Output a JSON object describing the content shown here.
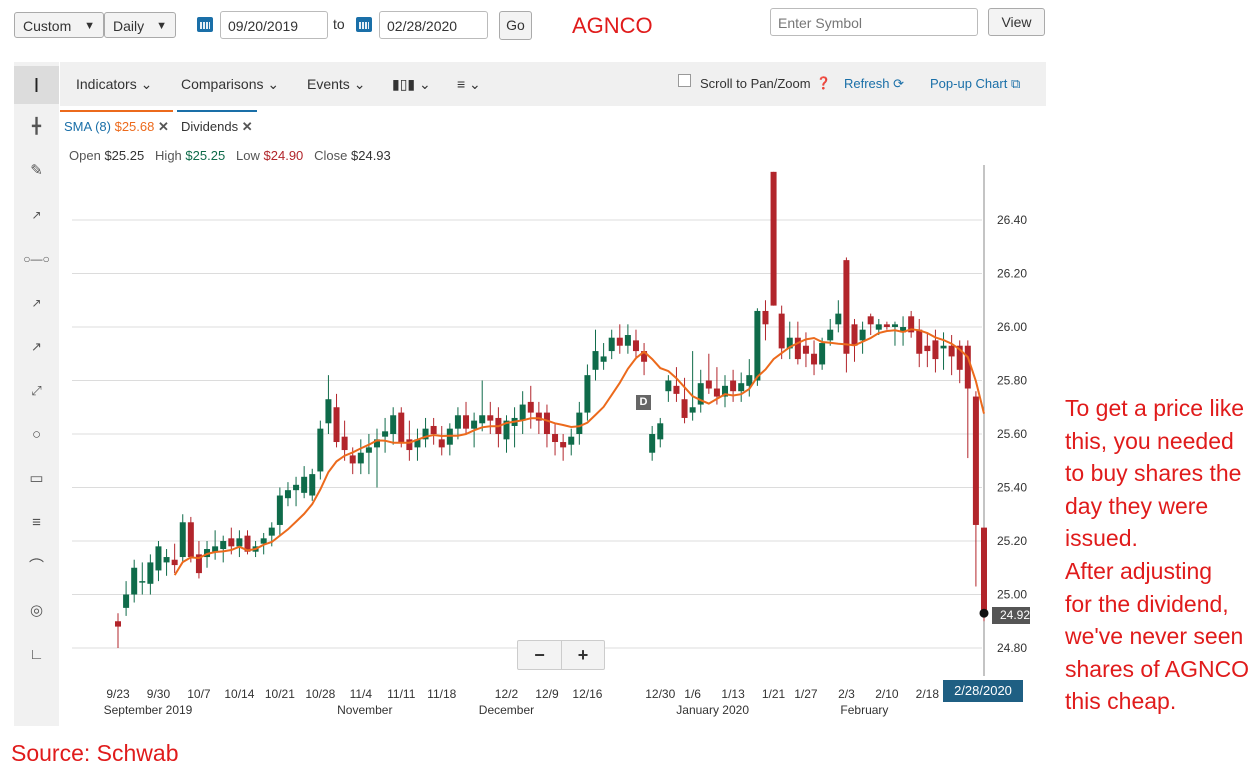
{
  "header": {
    "range_select": "Custom",
    "interval_select": "Daily",
    "start_date": "09/20/2019",
    "to_label": "to",
    "end_date": "02/28/2020",
    "go_label": "Go",
    "symbol": "AGNCO",
    "symbol_color": "#e01b1b",
    "symbol_input_placeholder": "Enter Symbol",
    "view_label": "View"
  },
  "toolbar": {
    "indicators": "Indicators",
    "comparisons": "Comparisons",
    "events": "Events",
    "scroll_label": "Scroll to Pan/Zoom",
    "refresh": "Refresh",
    "popup": "Pop-up Chart"
  },
  "legend": {
    "sma_label": "SMA (8)",
    "sma_value": "$25.68",
    "dividends": "Dividends"
  },
  "ohlc": {
    "open_label": "Open",
    "open": "$25.25",
    "high_label": "High",
    "high": "$25.25",
    "low_label": "Low",
    "low": "$24.90",
    "close_label": "Close",
    "close": "$24.93"
  },
  "zoom": {
    "minus": "−",
    "plus": "+"
  },
  "dividend_marker": "D",
  "last_price": "24.92",
  "current_date": "2/28/2020",
  "annotation": [
    "To get a price like",
    "this, you needed",
    "to buy shares the",
    "day they were",
    "issued.",
    "After adjusting",
    "for the dividend,",
    "we've never seen",
    "shares of AGNCO",
    "this cheap."
  ],
  "source": "Source: Schwab",
  "colors": {
    "up": "#0f6b4a",
    "down": "#b2252b",
    "sma": "#ec6a1c",
    "link": "#1a6fa8",
    "note": "#e01b1b"
  },
  "chart_data": {
    "type": "candlestick",
    "ylim": [
      24.7,
      26.58
    ],
    "yticks": [
      24.8,
      25.0,
      25.2,
      25.4,
      25.6,
      25.8,
      26.0,
      26.2,
      26.4
    ],
    "xtick_labels": [
      "9/23",
      "9/30",
      "10/7",
      "10/14",
      "10/21",
      "10/28",
      "11/4",
      "11/11",
      "11/18",
      "12/2",
      "12/9",
      "12/16",
      "12/30",
      "1/6",
      "1/13",
      "1/21",
      "1/27",
      "2/3",
      "2/10",
      "2/18"
    ],
    "month_labels": [
      "September 2019",
      "November",
      "December",
      "January 2020",
      "February"
    ],
    "candles": [
      [
        "9/23",
        24.9,
        24.93,
        24.8,
        24.88
      ],
      [
        "9/24",
        24.95,
        25.05,
        24.92,
        25.0
      ],
      [
        "9/25",
        25.0,
        25.13,
        24.97,
        25.1
      ],
      [
        "9/26",
        25.05,
        25.12,
        25.0,
        25.05
      ],
      [
        "9/27",
        25.04,
        25.15,
        25.0,
        25.12
      ],
      [
        "9/30",
        25.09,
        25.2,
        25.05,
        25.18
      ],
      [
        "10/1",
        25.12,
        25.17,
        25.07,
        25.14
      ],
      [
        "10/2",
        25.13,
        25.19,
        25.08,
        25.11
      ],
      [
        "10/3",
        25.14,
        25.3,
        25.12,
        25.27
      ],
      [
        "10/4",
        25.27,
        25.29,
        25.12,
        25.14
      ],
      [
        "10/7",
        25.15,
        25.2,
        25.06,
        25.08
      ],
      [
        "10/8",
        25.14,
        25.2,
        25.1,
        25.17
      ],
      [
        "10/9",
        25.16,
        25.24,
        25.13,
        25.18
      ],
      [
        "10/10",
        25.17,
        25.22,
        25.12,
        25.2
      ],
      [
        "10/11",
        25.21,
        25.25,
        25.15,
        25.18
      ],
      [
        "10/14",
        25.18,
        25.24,
        25.14,
        25.21
      ],
      [
        "10/15",
        25.22,
        25.24,
        25.15,
        25.16
      ],
      [
        "10/16",
        25.16,
        25.2,
        25.14,
        25.18
      ],
      [
        "10/17",
        25.19,
        25.23,
        25.15,
        25.21
      ],
      [
        "10/18",
        25.22,
        25.27,
        25.18,
        25.25
      ],
      [
        "10/21",
        25.26,
        25.4,
        25.22,
        25.37
      ],
      [
        "10/22",
        25.36,
        25.42,
        25.33,
        25.39
      ],
      [
        "10/23",
        25.39,
        25.44,
        25.33,
        25.41
      ],
      [
        "10/24",
        25.38,
        25.48,
        25.36,
        25.44
      ],
      [
        "10/25",
        25.37,
        25.47,
        25.35,
        25.45
      ],
      [
        "10/28",
        25.46,
        25.65,
        25.43,
        25.62
      ],
      [
        "10/29",
        25.64,
        25.82,
        25.6,
        25.73
      ],
      [
        "10/30",
        25.7,
        25.75,
        25.55,
        25.57
      ],
      [
        "10/31",
        25.59,
        25.65,
        25.5,
        25.54
      ],
      [
        "11/1",
        25.52,
        25.55,
        25.45,
        25.49
      ],
      [
        "11/4",
        25.49,
        25.58,
        25.45,
        25.53
      ],
      [
        "11/5",
        25.53,
        25.6,
        25.45,
        25.55
      ],
      [
        "11/6",
        25.55,
        25.62,
        25.4,
        25.58
      ],
      [
        "11/7",
        25.59,
        25.66,
        25.53,
        25.61
      ],
      [
        "11/8",
        25.6,
        25.7,
        25.56,
        25.67
      ],
      [
        "11/11",
        25.68,
        25.7,
        25.55,
        25.57
      ],
      [
        "11/12",
        25.58,
        25.65,
        25.5,
        25.54
      ],
      [
        "11/13",
        25.55,
        25.62,
        25.5,
        25.58
      ],
      [
        "11/14",
        25.58,
        25.66,
        25.55,
        25.62
      ],
      [
        "11/15",
        25.63,
        25.66,
        25.56,
        25.6
      ],
      [
        "11/18",
        25.58,
        25.63,
        25.52,
        25.55
      ],
      [
        "11/19",
        25.56,
        25.64,
        25.52,
        25.62
      ],
      [
        "11/20",
        25.62,
        25.7,
        25.58,
        25.67
      ],
      [
        "11/21",
        25.67,
        25.72,
        25.6,
        25.62
      ],
      [
        "11/22",
        25.62,
        25.68,
        25.55,
        25.65
      ],
      [
        "11/25",
        25.64,
        25.8,
        25.61,
        25.67
      ],
      [
        "11/26",
        25.67,
        25.72,
        25.6,
        25.65
      ],
      [
        "11/27",
        25.66,
        25.7,
        25.55,
        25.6
      ],
      [
        "12/2",
        25.58,
        25.67,
        25.53,
        25.65
      ],
      [
        "12/3",
        25.63,
        25.7,
        25.55,
        25.66
      ],
      [
        "12/4",
        25.65,
        25.76,
        25.6,
        25.71
      ],
      [
        "12/5",
        25.72,
        25.78,
        25.62,
        25.68
      ],
      [
        "12/6",
        25.68,
        25.72,
        25.6,
        25.65
      ],
      [
        "12/9",
        25.68,
        25.71,
        25.55,
        25.6
      ],
      [
        "12/10",
        25.6,
        25.64,
        25.52,
        25.57
      ],
      [
        "12/11",
        25.57,
        25.6,
        25.5,
        25.55
      ],
      [
        "12/12",
        25.56,
        25.62,
        25.52,
        25.59
      ],
      [
        "12/13",
        25.6,
        25.72,
        25.56,
        25.68
      ],
      [
        "12/16",
        25.68,
        25.86,
        25.65,
        25.82
      ],
      [
        "12/17",
        25.84,
        25.99,
        25.8,
        25.91
      ],
      [
        "12/18",
        25.87,
        25.94,
        25.84,
        25.89
      ],
      [
        "12/19",
        25.91,
        25.99,
        25.88,
        25.96
      ],
      [
        "12/20",
        25.96,
        26.01,
        25.9,
        25.93
      ],
      [
        "12/23",
        25.93,
        26.01,
        25.9,
        25.97
      ],
      [
        "12/24",
        25.95,
        25.99,
        25.88,
        25.91
      ],
      [
        "12/26",
        25.91,
        25.94,
        25.82,
        25.87
      ],
      [
        "12/27",
        25.53,
        25.63,
        25.5,
        25.6
      ],
      [
        "12/30",
        25.58,
        25.66,
        25.55,
        25.64
      ],
      [
        "12/31",
        25.76,
        25.82,
        25.72,
        25.8
      ],
      [
        "1/2",
        25.78,
        25.85,
        25.72,
        25.75
      ],
      [
        "1/3",
        25.73,
        25.81,
        25.64,
        25.66
      ],
      [
        "1/6",
        25.68,
        25.91,
        25.65,
        25.7
      ],
      [
        "1/7",
        25.71,
        25.84,
        25.68,
        25.79
      ],
      [
        "1/8",
        25.8,
        25.9,
        25.75,
        25.77
      ],
      [
        "1/9",
        25.77,
        25.85,
        25.71,
        25.74
      ],
      [
        "1/10",
        25.74,
        25.82,
        25.7,
        25.78
      ],
      [
        "1/13",
        25.8,
        25.84,
        25.72,
        25.76
      ],
      [
        "1/14",
        25.76,
        25.83,
        25.72,
        25.79
      ],
      [
        "1/15",
        25.78,
        25.88,
        25.74,
        25.82
      ],
      [
        "1/16",
        25.8,
        26.07,
        25.78,
        26.06
      ],
      [
        "1/17",
        26.06,
        26.1,
        25.95,
        26.01
      ],
      [
        "1/21",
        26.58,
        26.58,
        26.08,
        26.08
      ],
      [
        "1/22",
        26.05,
        26.08,
        25.88,
        25.92
      ],
      [
        "1/23",
        25.92,
        26.02,
        25.88,
        25.96
      ],
      [
        "1/24",
        25.96,
        26.02,
        25.86,
        25.88
      ],
      [
        "1/27",
        25.93,
        25.98,
        25.85,
        25.9
      ],
      [
        "1/28",
        25.9,
        25.95,
        25.82,
        25.86
      ],
      [
        "1/29",
        25.86,
        25.96,
        25.84,
        25.94
      ],
      [
        "1/30",
        25.95,
        26.03,
        25.93,
        25.99
      ],
      [
        "1/31",
        26.01,
        26.1,
        25.98,
        26.05
      ],
      [
        "2/3",
        26.25,
        26.26,
        25.83,
        25.9
      ],
      [
        "2/4",
        26.01,
        26.03,
        25.87,
        25.93
      ],
      [
        "2/5",
        25.95,
        26.02,
        25.9,
        25.99
      ],
      [
        "2/6",
        26.04,
        26.05,
        25.97,
        26.01
      ],
      [
        "2/7",
        25.99,
        26.03,
        25.97,
        26.01
      ],
      [
        "2/10",
        26.01,
        26.02,
        25.99,
        26.0
      ],
      [
        "2/11",
        26.0,
        26.02,
        25.93,
        26.01
      ],
      [
        "2/12",
        25.98,
        26.04,
        25.93,
        26.0
      ],
      [
        "2/13",
        26.04,
        26.06,
        25.96,
        25.98
      ],
      [
        "2/14",
        25.99,
        26.03,
        25.85,
        25.9
      ],
      [
        "2/18",
        25.93,
        25.98,
        25.85,
        25.91
      ],
      [
        "2/19",
        25.95,
        25.99,
        25.83,
        25.88
      ],
      [
        "2/20",
        25.92,
        25.98,
        25.84,
        25.93
      ],
      [
        "2/21",
        25.93,
        25.97,
        25.82,
        25.89
      ],
      [
        "2/24",
        25.93,
        25.95,
        25.79,
        25.84
      ],
      [
        "2/25",
        25.93,
        25.95,
        25.51,
        25.77
      ],
      [
        "2/26",
        25.74,
        25.76,
        25.03,
        25.26
      ],
      [
        "2/27",
        25.25,
        25.25,
        24.9,
        24.93
      ]
    ],
    "sma": {
      "name": "SMA (8)",
      "period": 8
    }
  }
}
